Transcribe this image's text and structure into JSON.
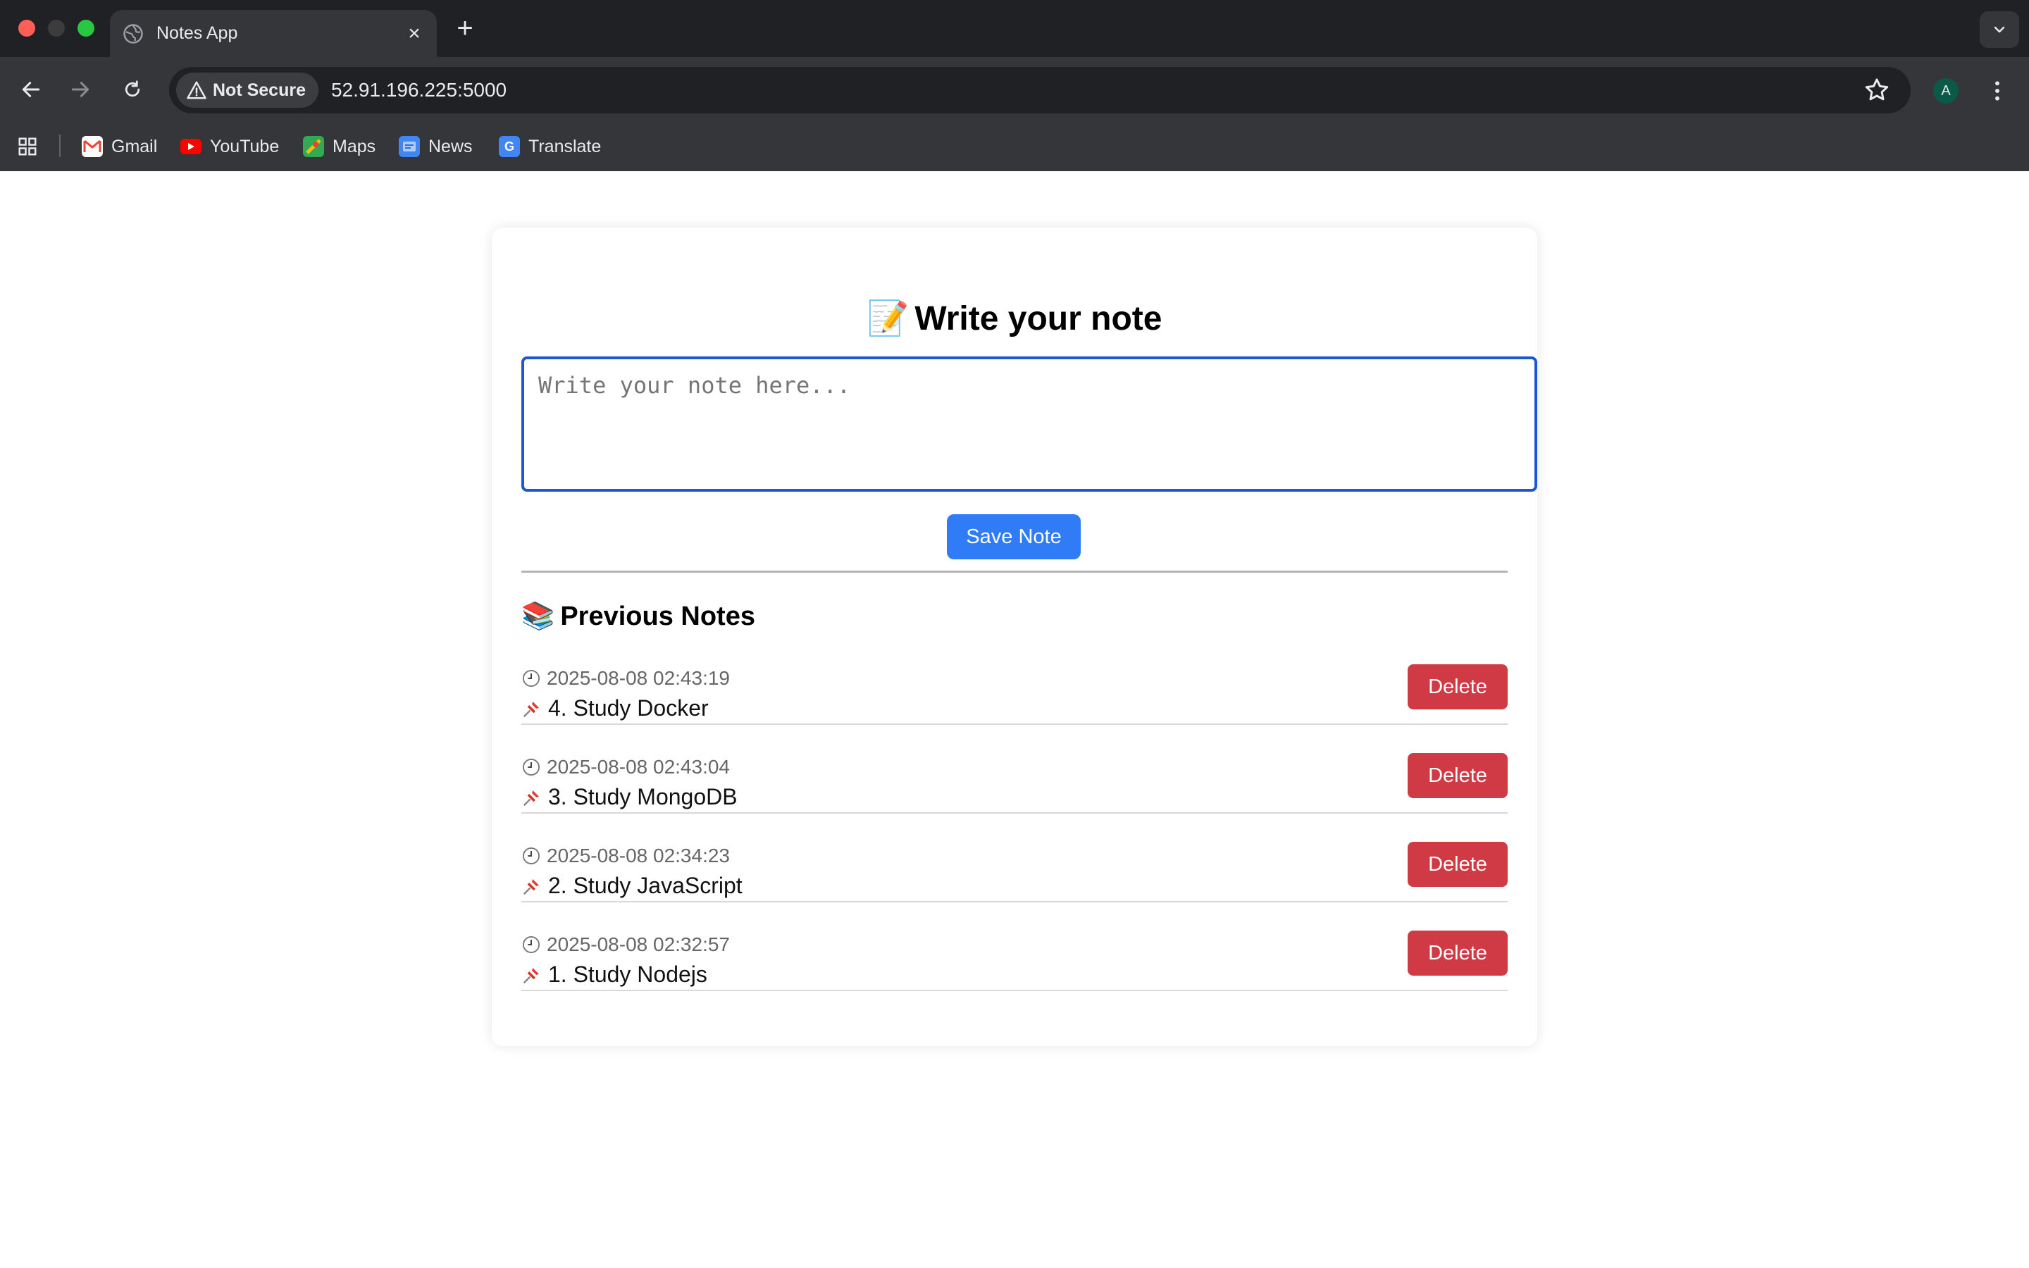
{
  "browser": {
    "tab": {
      "title": "Notes App",
      "close_label": "×"
    },
    "new_tab_label": "+",
    "security_label": "Not Secure",
    "url": "52.91.196.225:5000",
    "profile_initial": "A",
    "bookmarks": [
      {
        "label": "Gmail",
        "icon": "gmail-icon",
        "color": "#ea4335"
      },
      {
        "label": "YouTube",
        "icon": "youtube-icon",
        "color": "#ff0000"
      },
      {
        "label": "Maps",
        "icon": "maps-icon",
        "color": "#34a853"
      },
      {
        "label": "News",
        "icon": "news-icon",
        "color": "#4285f4"
      },
      {
        "label": "Translate",
        "icon": "translate-icon",
        "color": "#4285f4"
      }
    ]
  },
  "app": {
    "heading_icon": "📝",
    "heading": "Write your note",
    "input_placeholder": "Write your note here...",
    "save_label": "Save Note",
    "previous_icon": "📚",
    "previous_heading": "Previous Notes",
    "delete_label": "Delete",
    "notes": [
      {
        "timestamp": "2025-08-08 02:43:19",
        "text": "4. Study Docker"
      },
      {
        "timestamp": "2025-08-08 02:43:04",
        "text": "3. Study MongoDB"
      },
      {
        "timestamp": "2025-08-08 02:34:23",
        "text": "2. Study JavaScript"
      },
      {
        "timestamp": "2025-08-08 02:32:57",
        "text": "1. Study Nodejs"
      }
    ]
  },
  "colors": {
    "accent": "#2f7cf6",
    "danger": "#cf3a45",
    "focus_border": "#1a56d6"
  }
}
